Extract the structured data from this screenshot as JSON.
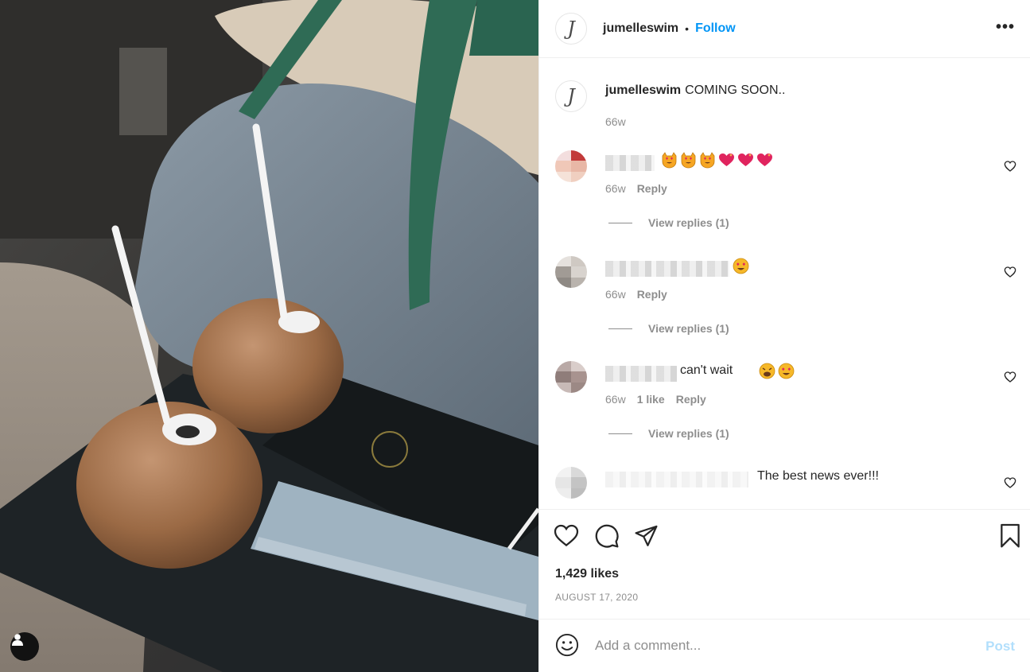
{
  "post": {
    "username": "jumelleswim",
    "avatar_letter": "J",
    "dot": "•",
    "follow_label": "Follow",
    "more_label": "•••",
    "caption_user": "jumelleswim",
    "caption_text": "COMING SOON..",
    "caption_time": "66w"
  },
  "comments": [
    {
      "text": "",
      "emojis": [
        "😻",
        "😻",
        "😻",
        "💖",
        "💖",
        "💖"
      ],
      "time": "66w",
      "likes": "",
      "reply": "Reply",
      "view_replies": "View replies (1)"
    },
    {
      "text": "",
      "emojis": [
        "😍"
      ],
      "time": "66w",
      "likes": "",
      "reply": "Reply",
      "view_replies": "View replies (1)"
    },
    {
      "text": "can't wait",
      "emojis": [
        "😩",
        "😍"
      ],
      "time": "66w",
      "likes": "1 like",
      "reply": "Reply",
      "view_replies": "View replies (1)"
    },
    {
      "text": "The best news ever!!!",
      "emojis": [],
      "time": "",
      "likes": "",
      "reply": "",
      "view_replies": ""
    }
  ],
  "stats": {
    "likes": "1,429 likes",
    "date": "AUGUST 17, 2020"
  },
  "composer": {
    "placeholder": "Add a comment...",
    "post_label": "Post"
  },
  "icons": {
    "like": "heart-icon",
    "comment": "comment-bubble-icon",
    "share": "paper-plane-icon",
    "save": "bookmark-icon",
    "emoji": "smiley-icon",
    "tagged_user": "user-icon"
  },
  "colors": {
    "accent": "#0095f6",
    "post_disabled": "#b2dffc",
    "muted": "#8e8e8e"
  }
}
